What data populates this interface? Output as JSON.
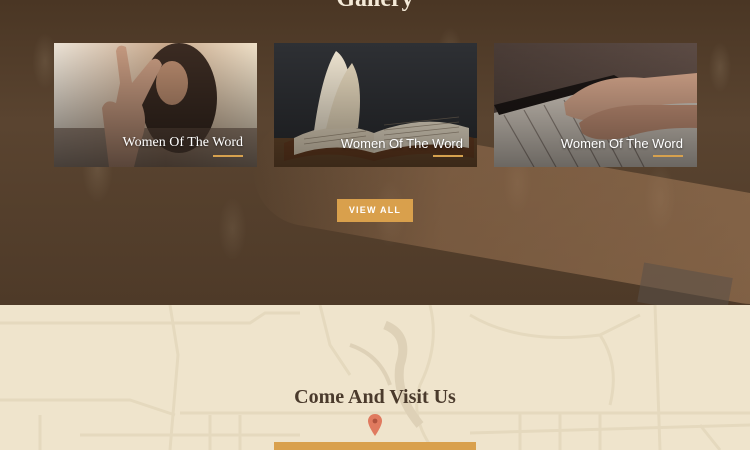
{
  "gallery": {
    "title": "Gallery",
    "cards": [
      {
        "caption": "Women Of The Word",
        "image": "peace-sign-hand-photo"
      },
      {
        "caption": "Women Of The Word",
        "image": "open-bible-photo"
      },
      {
        "caption": "Women Of The Word",
        "image": "piano-hands-photo"
      }
    ],
    "view_all_label": "VIEW ALL"
  },
  "visit": {
    "title": "Come And Visit Us"
  },
  "colors": {
    "accent": "#d9a04c",
    "hero_overlay": "#4e3a28",
    "map_background": "#efe5cd",
    "pin": "#e07a5f"
  }
}
